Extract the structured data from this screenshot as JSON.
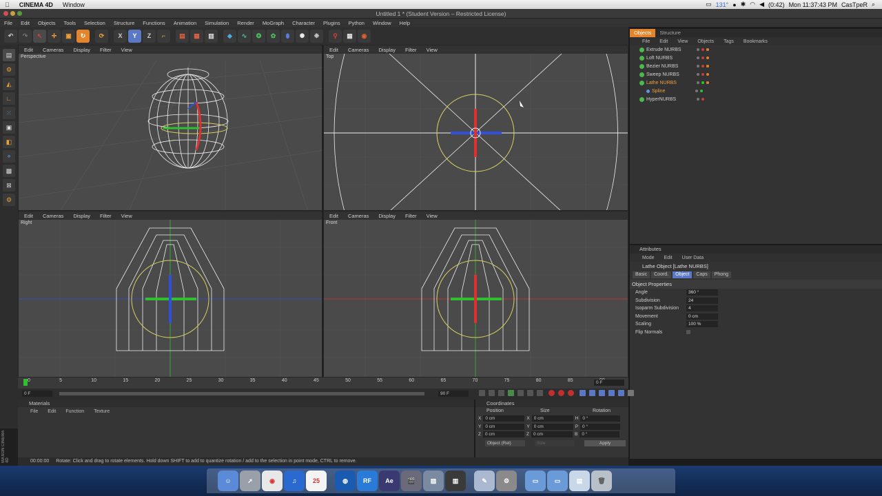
{
  "macbar": {
    "app_name": "CINEMA 4D",
    "menu": [
      "Window"
    ],
    "temp": "131°",
    "battery": "(0:42)",
    "clock": "Mon 11:37:43 PM",
    "user": "CasTpeR"
  },
  "window": {
    "title": "Untitled 1 * (Student Version – Restricted License)"
  },
  "main_menu": [
    "File",
    "Edit",
    "Objects",
    "Tools",
    "Selection",
    "Structure",
    "Functions",
    "Animation",
    "Simulation",
    "Render",
    "MoGraph",
    "Character",
    "Plugins",
    "Python",
    "Window",
    "Help"
  ],
  "viewport_menu": [
    "Edit",
    "Cameras",
    "Display",
    "Filter",
    "View"
  ],
  "viewports": {
    "perspective": "Perspective",
    "top": "Top",
    "right": "Right",
    "front": "Front"
  },
  "objects_panel": {
    "tabs": [
      "Objects",
      "Structure"
    ],
    "menu": [
      "File",
      "Edit",
      "View",
      "Objects",
      "Tags",
      "Bookmarks"
    ],
    "items": [
      {
        "name": "Extrude NURBS",
        "selected": false,
        "child": false
      },
      {
        "name": "Loft NURBS",
        "selected": false,
        "child": false
      },
      {
        "name": "Bezier NURBS",
        "selected": false,
        "child": false
      },
      {
        "name": "Sweep NURBS",
        "selected": false,
        "child": false
      },
      {
        "name": "Lathe NURBS",
        "selected": true,
        "child": false
      },
      {
        "name": "Spline",
        "selected": true,
        "child": true
      },
      {
        "name": "HyperNURBS",
        "selected": false,
        "child": false
      }
    ]
  },
  "attributes": {
    "header": "Attributes",
    "menu": [
      "Mode",
      "Edit",
      "User Data"
    ],
    "object_title": "Lathe Object [Lathe NURBS]",
    "tabs": [
      "Basic",
      "Coord.",
      "Object",
      "Caps",
      "Phong"
    ],
    "active_tab": "Object",
    "section": "Object Properties",
    "properties": [
      {
        "label": "Angle",
        "value": "360 °"
      },
      {
        "label": "Subdivision",
        "value": "24"
      },
      {
        "label": "Isoparm Subdivision",
        "value": "4"
      },
      {
        "label": "Movement",
        "value": "0 cm"
      },
      {
        "label": "Scaling",
        "value": "100 %"
      },
      {
        "label": "Flip Normals",
        "value": ""
      }
    ]
  },
  "timeline": {
    "ticks": [
      "0",
      "5",
      "10",
      "15",
      "20",
      "25",
      "30",
      "35",
      "40",
      "45",
      "50",
      "55",
      "60",
      "65",
      "70",
      "75",
      "80",
      "85",
      "90"
    ],
    "current_frame": "0 F",
    "start_field": "0 F",
    "end_field": "90 F",
    "frame_display": "0 F"
  },
  "materials": {
    "header": "Materials",
    "menu": [
      "File",
      "Edit",
      "Function",
      "Texture"
    ]
  },
  "coordinates": {
    "header": "Coordinates",
    "columns": [
      "Position",
      "Size",
      "Rotation"
    ],
    "rows": [
      {
        "axis": "X",
        "pos": "0 cm",
        "size_axis": "X",
        "size": "0 cm",
        "rot_axis": "H",
        "rot": "0 °"
      },
      {
        "axis": "Y",
        "pos": "0 cm",
        "size_axis": "Y",
        "size": "0 cm",
        "rot_axis": "P",
        "rot": "0 °"
      },
      {
        "axis": "Z",
        "pos": "0 cm",
        "size_axis": "Z",
        "size": "0 cm",
        "rot_axis": "B",
        "rot": "0 °"
      }
    ],
    "mode": "Object (Rel)",
    "size_mode": "Size",
    "apply": "Apply"
  },
  "status": {
    "time": "00:00:00",
    "message": "Rotate: Click and drag to rotate elements. Hold down SHIFT to add to quantize rotation / add to the selection in point mode, CTRL to remove."
  },
  "side_logo": "MAXON CINEMA 4D",
  "dock": {
    "calendar_day": "25",
    "apps": [
      "Finder",
      "Launchpad",
      "Chrome",
      "iTunes",
      "Calendar",
      "Earth",
      "RealFlow",
      "After Effects",
      "Clapper",
      "Photo",
      "Piano",
      "Preview",
      "System Preferences",
      "Folder",
      "Folder",
      "Downloads",
      "Trash"
    ]
  },
  "colors": {
    "accent": "#e4842b",
    "axis_x": "#e03030",
    "axis_y": "#30c030",
    "axis_z": "#3050e0",
    "wire": "#f0f0f0",
    "spline": "#d8d060"
  }
}
